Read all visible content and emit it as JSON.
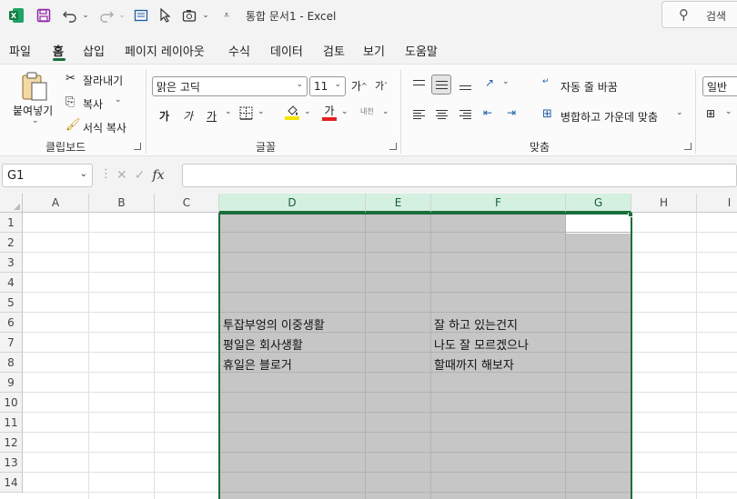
{
  "titlebar": {
    "title": "통합 문서1  -  Excel",
    "search_label": "검색",
    "icons": [
      "excel-logo-icon",
      "save-icon",
      "undo-icon",
      "redo-icon",
      "form-icon",
      "pointer-icon",
      "camera-icon",
      "customize-qat-icon"
    ]
  },
  "tabs": [
    "파일",
    "홈",
    "삽입",
    "페이지 레이아웃",
    "수식",
    "데이터",
    "검토",
    "보기",
    "도움말"
  ],
  "active_tab": "홈",
  "ribbon": {
    "clipboard": {
      "paste_label": "붙여넣기",
      "cut_label": "잘라내기",
      "copy_label": "복사",
      "format_painter_label": "서식 복사",
      "group_label": "클립보드"
    },
    "font": {
      "font_name": "맑은 고딕",
      "font_size": "11",
      "grow_label": "가",
      "shrink_label": "가",
      "bold_label": "가",
      "italic_label": "가",
      "underline_label": "가",
      "font_color_label": "가",
      "phonetic_label": "내천",
      "group_label": "글꼴",
      "fill_color": "#f5e400",
      "font_color": "#e02020"
    },
    "alignment": {
      "wrap_label": "자동 줄 바꿈",
      "merge_label": "병합하고 가운데 맞춤",
      "group_label": "맞춤",
      "wrap_icon_text": "가나\n다"
    },
    "number": {
      "format": "일반"
    }
  },
  "formula_bar": {
    "name_box": "G1",
    "fx_label": "fx",
    "formula": ""
  },
  "sheet": {
    "columns": [
      "A",
      "B",
      "C",
      "D",
      "E",
      "F",
      "G",
      "H",
      "I"
    ],
    "rows": [
      "1",
      "2",
      "3",
      "4",
      "5",
      "6",
      "7",
      "8",
      "9",
      "10",
      "11",
      "12",
      "13",
      "14"
    ],
    "cells": {
      "D6": "투잡부엉의 이중생활",
      "D7": "평일은 회사생활",
      "D8": "휴일은 블로거",
      "F6": "잘 하고 있는건지",
      "F7": "나도 잘 모르겠으나",
      "F8": "할때까지 해보자"
    },
    "selected_range": "D:G",
    "active_cell": "G1"
  },
  "colors": {
    "accent": "#1b6e3c",
    "selection_fill": "#c6c6c6"
  }
}
